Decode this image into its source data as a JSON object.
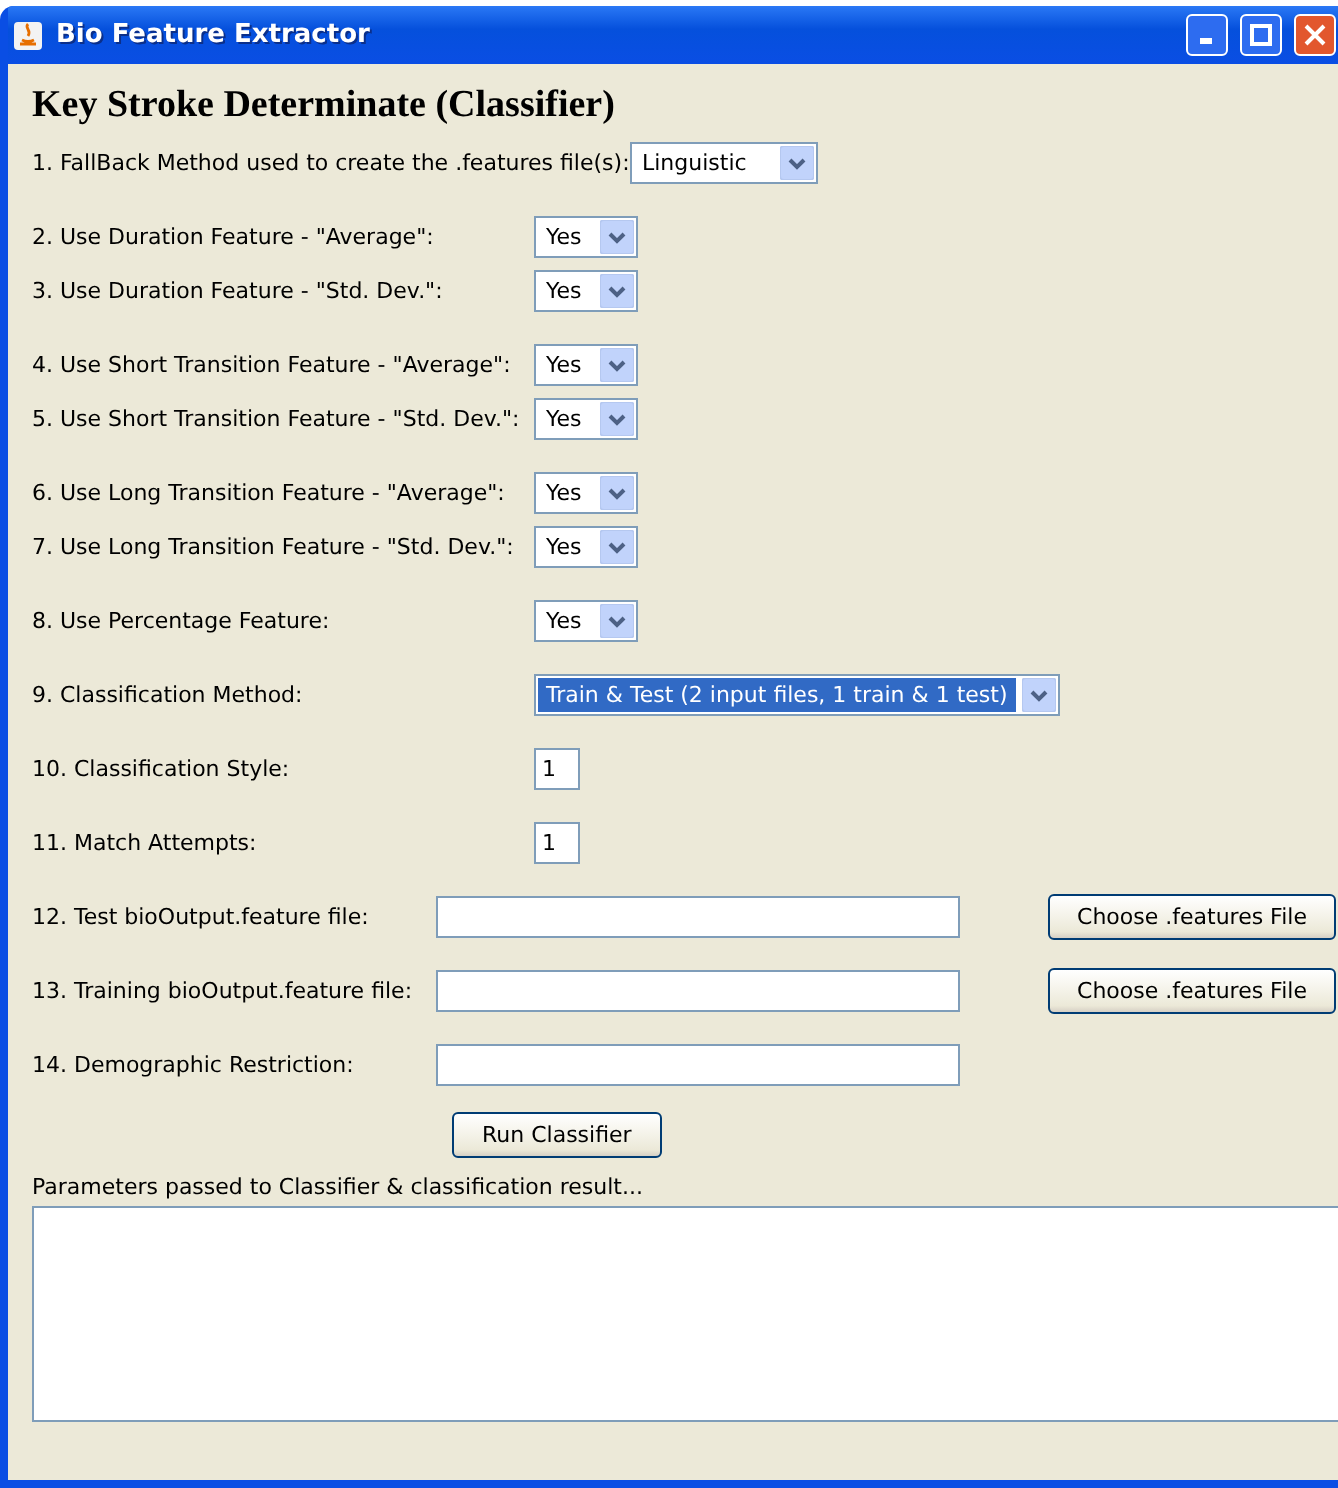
{
  "window": {
    "title": "Bio Feature Extractor"
  },
  "heading": "Key Stroke Determinate (Classifier)",
  "groups": [
    [
      {
        "kind": "select",
        "label": "1. FallBack Method used to create the .features file(s):",
        "value": "Linguistic",
        "highlighted": false
      }
    ],
    [
      {
        "kind": "select",
        "label": "2. Use Duration Feature - \"Average\":",
        "value": "Yes",
        "highlighted": false
      },
      {
        "kind": "select",
        "label": "3. Use Duration Feature - \"Std. Dev.\":",
        "value": "Yes",
        "highlighted": false
      }
    ],
    [
      {
        "kind": "select",
        "label": "4. Use Short Transition Feature - \"Average\":",
        "value": "Yes",
        "highlighted": false
      },
      {
        "kind": "select",
        "label": "5. Use Short Transition Feature - \"Std. Dev.\":",
        "value": "Yes",
        "highlighted": false
      }
    ],
    [
      {
        "kind": "select",
        "label": "6. Use Long Transition Feature - \"Average\":",
        "value": "Yes",
        "highlighted": false
      },
      {
        "kind": "select",
        "label": "7. Use Long Transition Feature - \"Std. Dev.\":",
        "value": "Yes",
        "highlighted": false
      }
    ],
    [
      {
        "kind": "select",
        "label": "8. Use Percentage Feature:",
        "value": "Yes",
        "highlighted": false
      }
    ],
    [
      {
        "kind": "select",
        "label": "9. Classification Method:",
        "value": "Train & Test (2 input files, 1 train & 1 test)",
        "highlighted": true
      }
    ],
    [
      {
        "kind": "number",
        "label": "10. Classification Style:",
        "value": "1"
      }
    ],
    [
      {
        "kind": "number",
        "label": "11. Match Attempts:",
        "value": "1"
      }
    ],
    [
      {
        "kind": "file",
        "label": "12. Test bioOutput.feature file:",
        "button": "Choose .features File"
      }
    ],
    [
      {
        "kind": "file",
        "label": "13. Training bioOutput.feature file:",
        "button": "Choose .features File"
      }
    ],
    [
      {
        "kind": "field",
        "label": "14. Demographic Restriction:"
      }
    ]
  ],
  "run_button": "Run Classifier",
  "output": {
    "label": "Parameters passed to Classifier & classification result..."
  }
}
